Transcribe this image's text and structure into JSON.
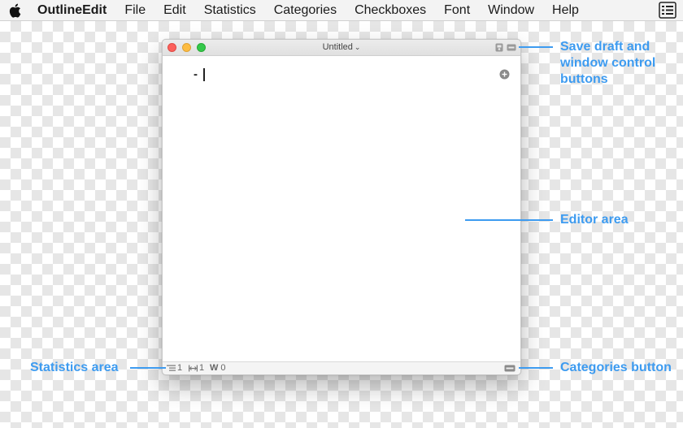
{
  "menubar": {
    "app_name": "OutlineEdit",
    "items": [
      "File",
      "Edit",
      "Statistics",
      "Categories",
      "Checkboxes",
      "Font",
      "Window",
      "Help"
    ]
  },
  "window": {
    "title": "Untitled",
    "title_chevron": "⌄",
    "editor": {
      "bullet": "-"
    },
    "statusbar": {
      "lines": "1",
      "characters": "1",
      "words_label": "W",
      "words": "0"
    }
  },
  "annotations": {
    "save_draft": [
      "Save draft and",
      "window control",
      "buttons"
    ],
    "editor_area": "Editor area",
    "statistics_area": "Statistics area",
    "categories_button": "Categories button"
  },
  "colors": {
    "annotation": "#3d9bf0",
    "close": "#fc605b",
    "minimize": "#fdbc40",
    "maximize": "#34c84a"
  }
}
